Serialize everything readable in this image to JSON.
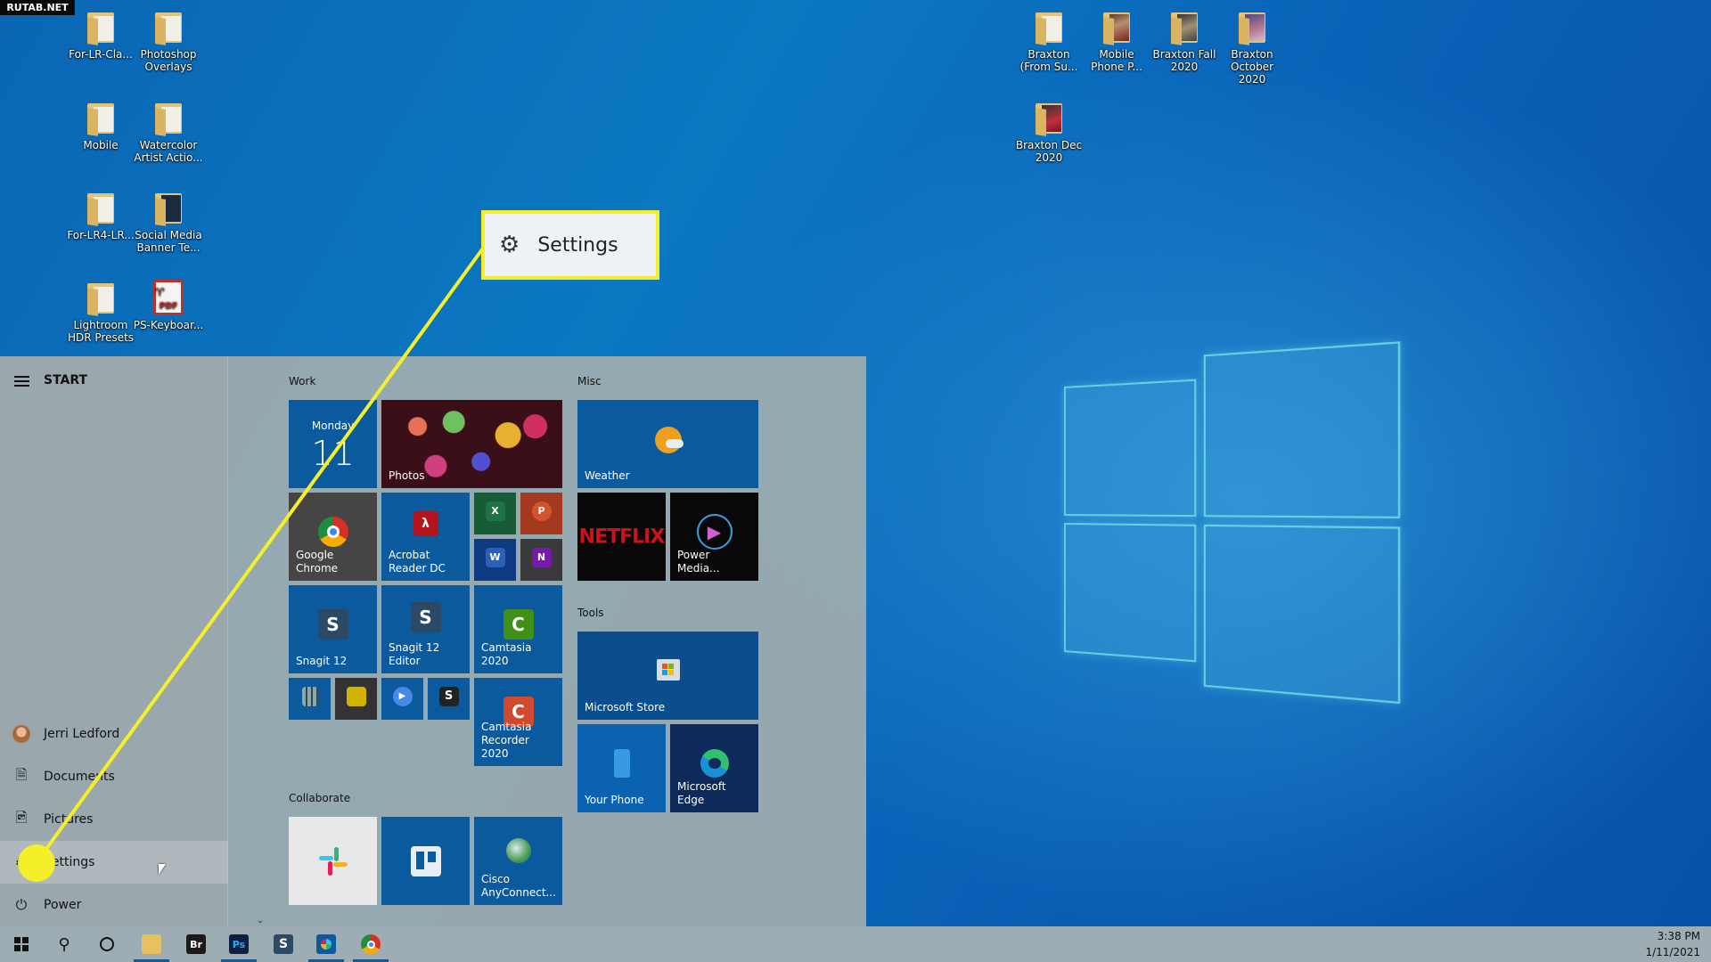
{
  "watermark": "RUTAB.NET",
  "desktop": {
    "left_icons": [
      {
        "label": "For-LR-Cla...",
        "type": "folder"
      },
      {
        "label": "Photoshop Overlays",
        "type": "folder"
      },
      {
        "label": "Mobile",
        "type": "folder"
      },
      {
        "label": "Watercolor Artist Actio...",
        "type": "folder"
      },
      {
        "label": "For-LR4-LR...",
        "type": "folder"
      },
      {
        "label": "Social Media Banner Te...",
        "type": "folder"
      },
      {
        "label": "Lightroom HDR Presets",
        "type": "folder"
      },
      {
        "label": "PS-Keyboar...",
        "type": "pdf",
        "badge": "PDF"
      }
    ],
    "right_icons": [
      {
        "label": "Braxton (From Su...",
        "type": "folder"
      },
      {
        "label": "Mobile Phone P...",
        "type": "photo-folder"
      },
      {
        "label": "Braxton Fall 2020",
        "type": "photo-folder"
      },
      {
        "label": "Braxton October 2020",
        "type": "photo-folder"
      },
      {
        "label": "Braxton Dec 2020",
        "type": "photo-folder"
      }
    ]
  },
  "start_menu": {
    "title": "START",
    "nav": [
      {
        "label": "Jerri Ledford",
        "icon": "user-avatar"
      },
      {
        "label": "Documents",
        "icon": "document-icon"
      },
      {
        "label": "Pictures",
        "icon": "pictures-icon"
      },
      {
        "label": "Settings",
        "icon": "gear-icon",
        "active": true
      },
      {
        "label": "Power",
        "icon": "power-icon"
      }
    ],
    "groups": {
      "work": {
        "label": "Work",
        "calendar": {
          "day": "Monday",
          "date": "11"
        },
        "tiles": {
          "photos": "Photos",
          "chrome": "Google Chrome",
          "acrobat": "Acrobat Reader DC",
          "excel": "X",
          "powerpoint": "P",
          "word": "W",
          "onenote": "N",
          "snagit": "Snagit 12",
          "snagit_editor": "Snagit 12 Editor",
          "camtasia": "Camtasia 2020",
          "camtasia_recorder": "Camtasia Recorder 2020"
        }
      },
      "misc": {
        "label": "Misc",
        "tiles": {
          "weather": "Weather",
          "netflix": "NETFLIX",
          "power_media": "Power Media..."
        }
      },
      "tools": {
        "label": "Tools",
        "tiles": {
          "store": "Microsoft Store",
          "your_phone": "Your Phone",
          "edge": "Microsoft Edge"
        }
      },
      "collaborate": {
        "label": "Collaborate",
        "tiles": {
          "cisco": "Cisco AnyConnect..."
        }
      }
    }
  },
  "callout": {
    "label": "Settings"
  },
  "taskbar": {
    "bridge": "Br",
    "photoshop": "Ps",
    "snagit": "S",
    "time": "3:38 PM",
    "date": "1/11/2021"
  },
  "colors": {
    "highlight": "#f5ef2a",
    "tile_blue": "#0b5a9e"
  }
}
